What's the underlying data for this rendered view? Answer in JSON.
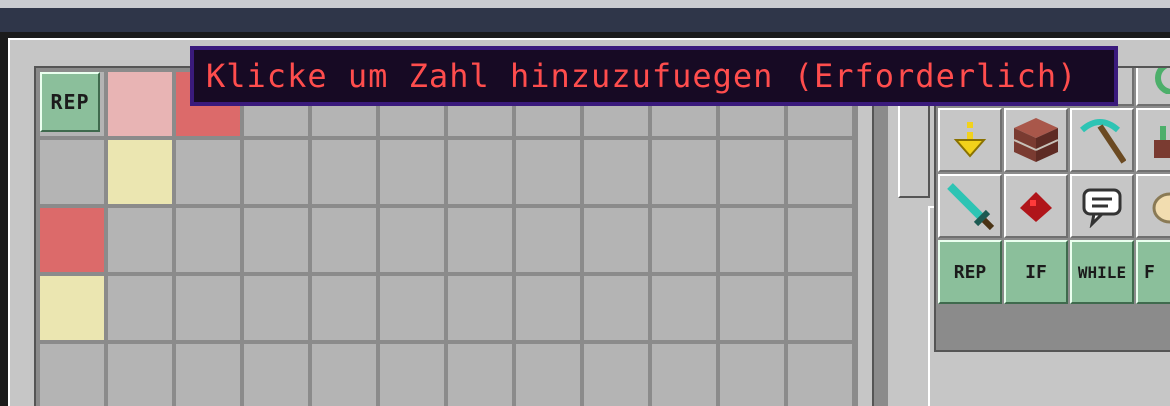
{
  "tooltip": {
    "text": "Klicke um Zahl hinzuzufuegen (Erforderlich)"
  },
  "grid": {
    "rep_label": "REP",
    "highlighted_cells": [
      {
        "row": 0,
        "col": 1,
        "color": "#e8b4b4"
      },
      {
        "row": 0,
        "col": 2,
        "color": "#dc6a6a"
      },
      {
        "row": 1,
        "col": 1,
        "color": "#ebe6b1"
      },
      {
        "row": 2,
        "col": 0,
        "color": "#dc6a6a"
      },
      {
        "row": 3,
        "col": 0,
        "color": "#ebe6b1"
      }
    ]
  },
  "palette": {
    "row1_icons": [
      "up-arrow-icon",
      "down-arrow-icon",
      "rotate-icon",
      "rotate-icon"
    ],
    "row2_icons": [
      "drop-arrow-icon",
      "brick-block-icon",
      "diamond-pickaxe-icon",
      "place-block-icon"
    ],
    "row3_icons": [
      "diamond-sword-icon",
      "redstone-icon",
      "speech-bubble-icon",
      "egg-icon"
    ],
    "buttons": [
      "REP",
      "IF",
      "WHILE",
      "F"
    ]
  },
  "colors": {
    "tooltip_text": "#ff4d4d",
    "tooltip_border": "#3a1a7c",
    "button_green": "#8bbf9b"
  }
}
